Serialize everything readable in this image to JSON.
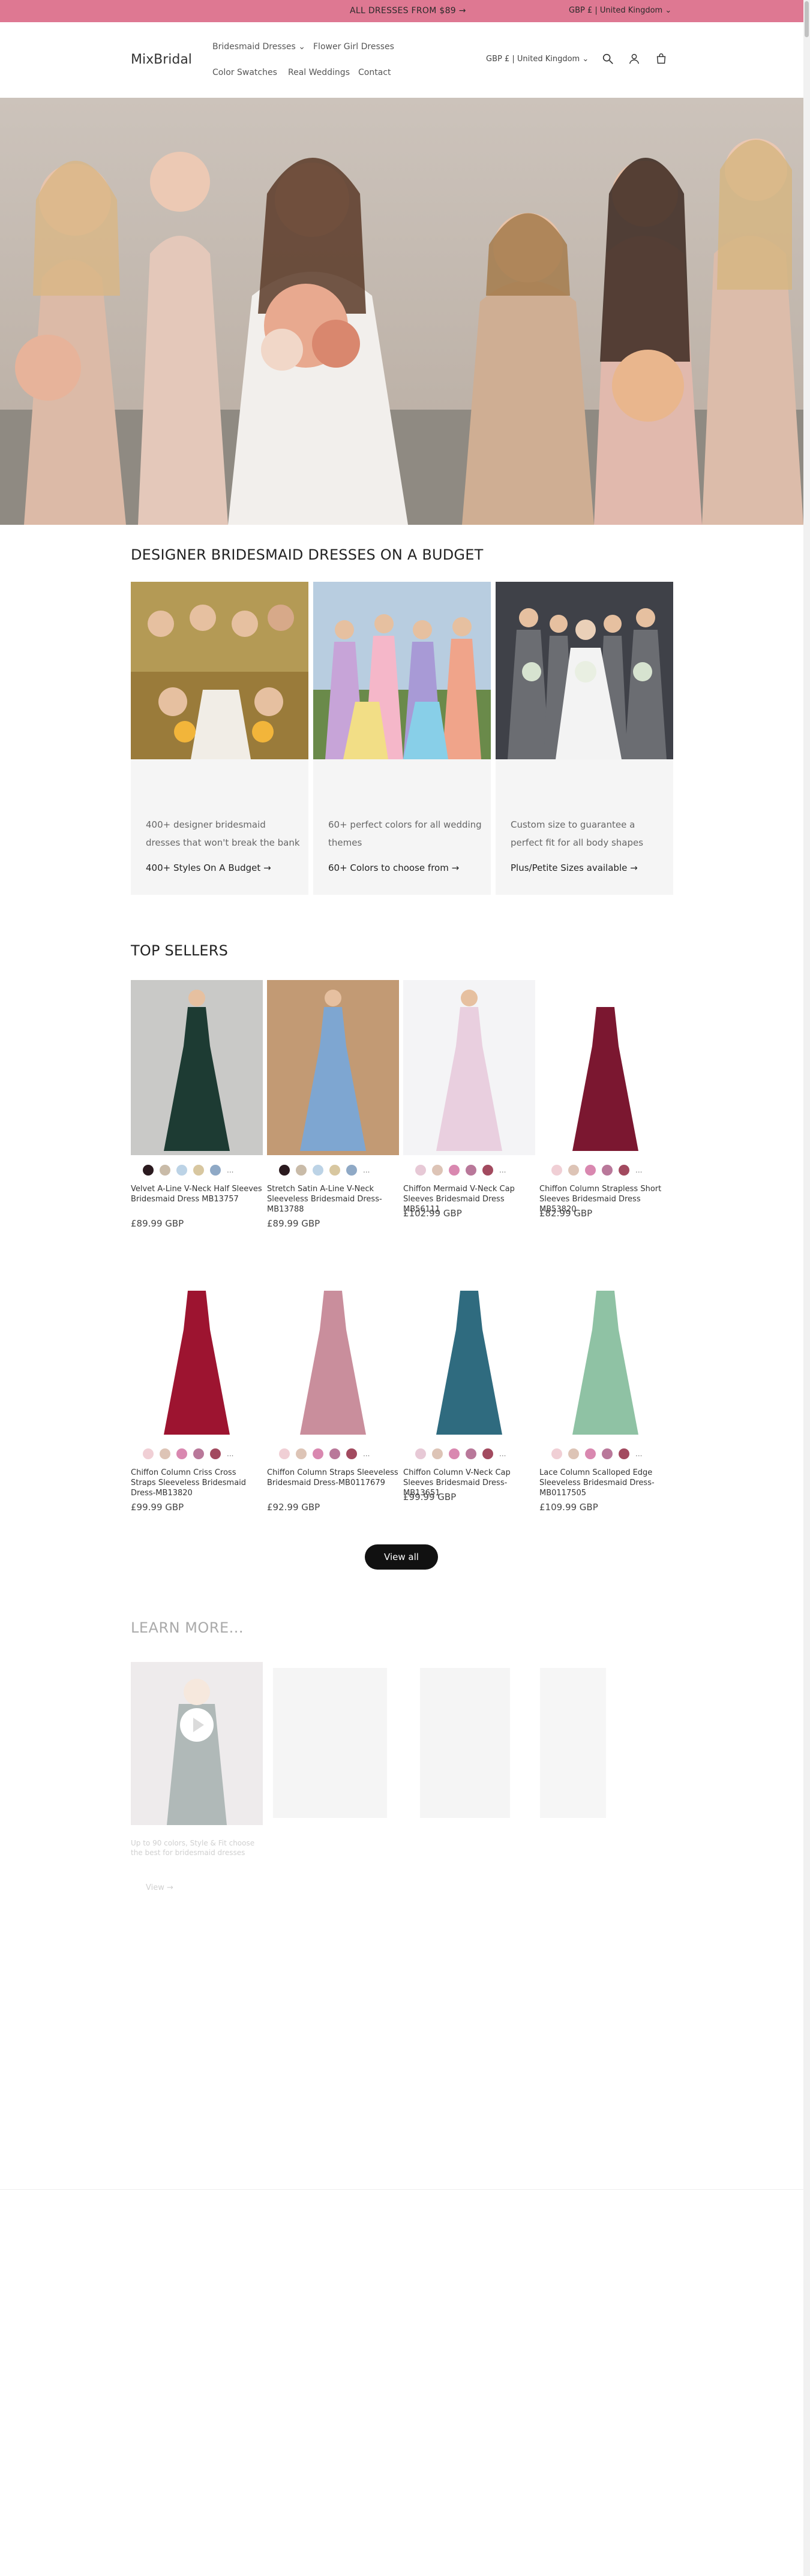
{
  "announcement": {
    "message": "ALL DRESSES FROM $89",
    "region_selector": "GBP £ | United Kingdom"
  },
  "header": {
    "logo": "MixBridal",
    "nav": {
      "bridesmaid": "Bridesmaid Dresses",
      "flower_girl": "Flower Girl Dresses",
      "swatches": "Color Swatches",
      "weddings": "Real Weddings",
      "contact": "Contact"
    },
    "currency": "GBP £ | United Kingdom"
  },
  "budget_section": {
    "title": "DESIGNER BRIDESMAID DRESSES ON A BUDGET",
    "cards": [
      {
        "desc": "400+ designer bridesmaid dresses that won't break the bank",
        "link": "400+ Styles On A Budget"
      },
      {
        "desc": "60+ perfect colors for all wedding themes",
        "link": "60+ Colors to choose from"
      },
      {
        "desc": "Custom size to guarantee a perfect fit for all body shapes",
        "link": "Plus/Petite Sizes available"
      }
    ]
  },
  "top_sellers": {
    "title": "TOP SELLERS",
    "products": [
      {
        "title": "Velvet A-Line V-Neck Half Sleeves Bridesmaid Dress MB13757",
        "price": "£89.99 GBP",
        "color": "#1d3b33",
        "bg": "#c9c9c7",
        "swatches": [
          "#2b1a1f",
          "#c9bba8",
          "#bcd3e6",
          "#d8c7a0",
          "#8fa9c6"
        ]
      },
      {
        "title": "Stretch Satin A-Line V-Neck Sleeveless Bridesmaid Dress-MB13788",
        "price": "£89.99 GBP",
        "color": "#7ea6d1",
        "bg": "#c29a74",
        "swatches": [
          "#2b1a1f",
          "#c9bba8",
          "#bcd3e6",
          "#d8c7a0",
          "#8fa9c6"
        ]
      },
      {
        "title": "Chiffon Mermaid V-Neck Cap Sleeves Bridesmaid Dress MB56111",
        "price": "£102.99 GBP",
        "color": "#e9cfdf",
        "bg": "#f4f4f6",
        "swatches": [
          "#e7c9d6",
          "#ddc4b6",
          "#d988b0",
          "#b9789a",
          "#a24a5f"
        ]
      },
      {
        "title": "Chiffon Column Strapless Short Sleeves Bridesmaid Dress MB53820",
        "price": "£82.99 GBP",
        "color": "#7b1730",
        "bg": "#ffffff",
        "swatches": [
          "#f0cfd5",
          "#ddc4b6",
          "#d988b0",
          "#b9789a",
          "#a24a5f"
        ]
      },
      {
        "title": "Chiffon Column Criss Cross Straps Sleeveless Bridesmaid Dress-MB13820",
        "price": "£99.99 GBP",
        "color": "#9d1430",
        "bg": "#ffffff",
        "swatches": [
          "#f0cfd5",
          "#ddc4b6",
          "#d988b0",
          "#b9789a",
          "#a24a5f"
        ]
      },
      {
        "title": "Chiffon Column Straps Sleeveless Bridesmaid Dress-MB0117679",
        "price": "£92.99 GBP",
        "color": "#c98e9c",
        "bg": "#ffffff",
        "swatches": [
          "#f0cfd5",
          "#ddc4b6",
          "#d988b0",
          "#b9789a",
          "#a24a5f"
        ]
      },
      {
        "title": "Chiffon Column V-Neck Cap Sleeves Bridesmaid Dress-MB13651",
        "price": "£99.99 GBP",
        "color": "#2f6b7f",
        "bg": "#ffffff",
        "swatches": [
          "#e7c9d6",
          "#ddc4b6",
          "#d988b0",
          "#b9789a",
          "#a24a5f"
        ]
      },
      {
        "title": "Lace Column Scalloped Edge Sleeveless Bridesmaid Dress-MB0117505",
        "price": "£109.99 GBP",
        "color": "#8fc2a4",
        "bg": "#ffffff",
        "swatches": [
          "#f0cfd5",
          "#ddc4b6",
          "#d988b0",
          "#b9789a",
          "#a24a5f"
        ]
      }
    ],
    "more_label": "...",
    "view_all": "View all"
  },
  "learn_more": {
    "title": "LEARN MORE...",
    "video_caption": "Up to 90 colors, Style & Fit choose the best for bridesmaid dresses",
    "view": "View"
  }
}
